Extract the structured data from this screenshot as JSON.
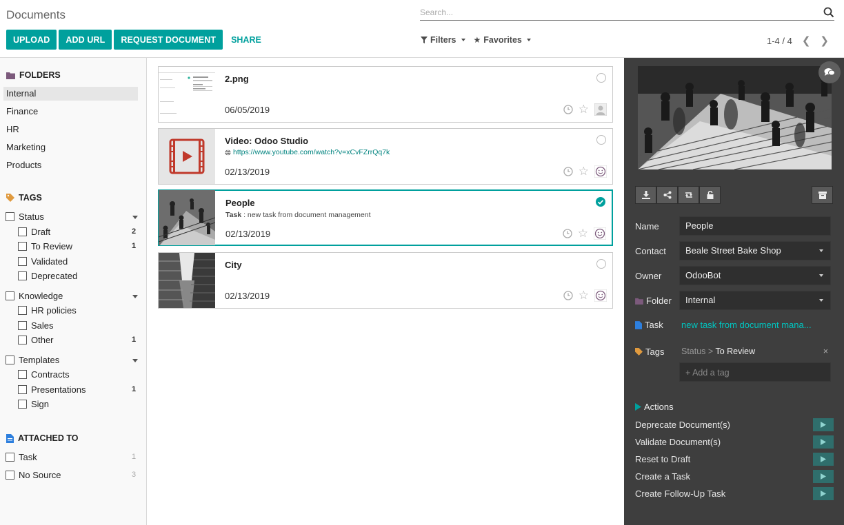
{
  "control_panel": {
    "title": "Documents",
    "search_placeholder": "Search...",
    "buttons": {
      "upload": "UPLOAD",
      "add_url": "ADD URL",
      "request": "REQUEST DOCUMENT",
      "share": "SHARE"
    },
    "filters_label": "Filters",
    "favorites_label": "Favorites",
    "pager": "1-4 / 4"
  },
  "sidebar": {
    "folders_title": "FOLDERS",
    "folders": [
      "Internal",
      "Finance",
      "HR",
      "Marketing",
      "Products"
    ],
    "active_folder": "Internal",
    "tags_title": "TAGS",
    "tag_groups": [
      {
        "label": "Status",
        "items": [
          {
            "label": "Draft",
            "count": "2"
          },
          {
            "label": "To Review",
            "count": "1"
          },
          {
            "label": "Validated",
            "count": ""
          },
          {
            "label": "Deprecated",
            "count": ""
          }
        ]
      },
      {
        "label": "Knowledge",
        "items": [
          {
            "label": "HR policies",
            "count": ""
          },
          {
            "label": "Sales",
            "count": ""
          },
          {
            "label": "Other",
            "count": "1"
          }
        ]
      },
      {
        "label": "Templates",
        "items": [
          {
            "label": "Contracts",
            "count": ""
          },
          {
            "label": "Presentations",
            "count": "1"
          },
          {
            "label": "Sign",
            "count": ""
          }
        ]
      }
    ],
    "attached_title": "ATTACHED TO",
    "attached": [
      {
        "label": "Task",
        "count": "1"
      },
      {
        "label": "No Source",
        "count": "3"
      }
    ]
  },
  "cards": [
    {
      "name": "2.png",
      "subtitle": "",
      "url": "",
      "date": "06/05/2019",
      "selected": false
    },
    {
      "name": "Video: Odoo Studio",
      "subtitle": "",
      "url": "https://www.youtube.com/watch?v=xCvFZrrQq7k",
      "date": "02/13/2019",
      "selected": false
    },
    {
      "name": "People",
      "subtitle_label": "Task",
      "subtitle": " : new task from document management",
      "url": "",
      "date": "02/13/2019",
      "selected": true
    },
    {
      "name": "City",
      "subtitle": "",
      "url": "",
      "date": "02/13/2019",
      "selected": false
    }
  ],
  "inspector": {
    "fields": {
      "name_label": "Name",
      "name": "People",
      "contact_label": "Contact",
      "contact": "Beale Street Bake Shop",
      "owner_label": "Owner",
      "owner": "OdooBot",
      "folder_label": "Folder",
      "folder": "Internal",
      "task_label": "Task",
      "task": "new task from document mana...",
      "tags_label": "Tags",
      "tag_path": "Status > ",
      "tag_value": "To Review",
      "add_tag": "+ Add a tag"
    },
    "actions_title": "Actions",
    "actions": [
      "Deprecate Document(s)",
      "Validate Document(s)",
      "Reset to Draft",
      "Create a Task",
      "Create Follow-Up Task"
    ]
  },
  "colors": {
    "accent": "#00a09d",
    "inspector_bg": "#3e3e3e",
    "input_bg": "#2f2f2f",
    "folder_icon": "#7c5a7c",
    "tag_icon": "#e09a3e",
    "doc_icon": "#2d7fde"
  }
}
